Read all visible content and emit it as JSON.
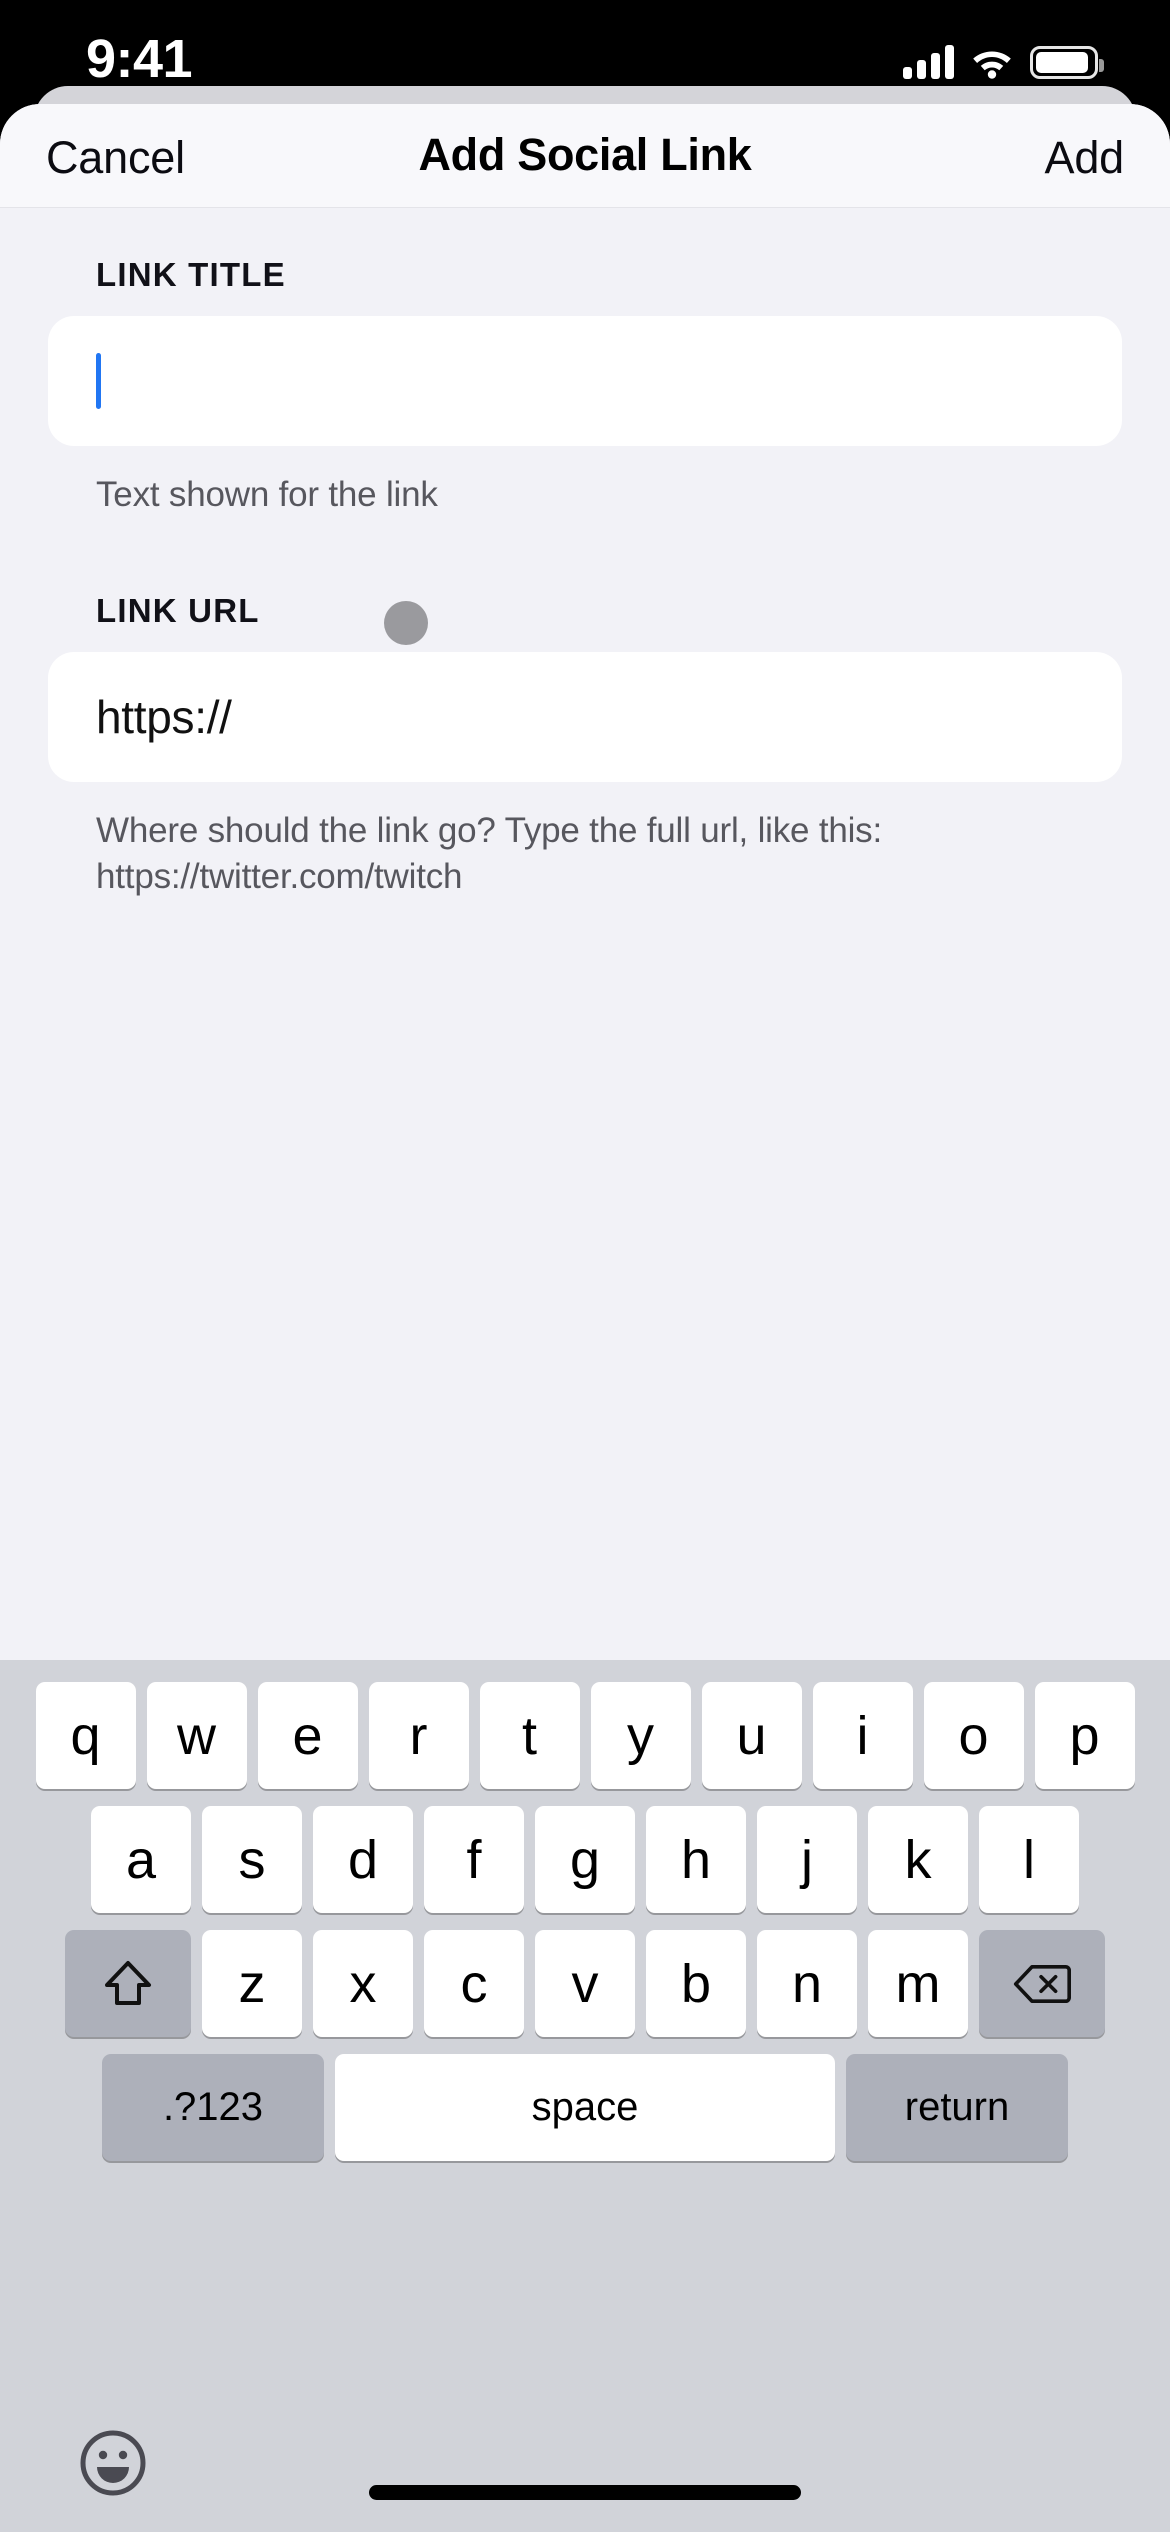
{
  "status_bar": {
    "time": "9:41",
    "cellular_icon": "cellular-bars-icon",
    "wifi_icon": "wifi-icon",
    "battery_icon": "battery-icon"
  },
  "nav_bar": {
    "cancel_label": "Cancel",
    "title": "Add Social Link",
    "add_label": "Add"
  },
  "form": {
    "title_field": {
      "label": "LINK TITLE",
      "value": "",
      "placeholder": "",
      "help": "Text shown for the link"
    },
    "url_field": {
      "label": "LINK URL",
      "value": "https://",
      "placeholder": "https://",
      "help": "Where should the link go? Type the full url, like this: https://twitter.com/twitch"
    }
  },
  "keyboard": {
    "row1": [
      "q",
      "w",
      "e",
      "r",
      "t",
      "y",
      "u",
      "i",
      "o",
      "p"
    ],
    "row2": [
      "a",
      "s",
      "d",
      "f",
      "g",
      "h",
      "j",
      "k",
      "l"
    ],
    "row3_letters": [
      "z",
      "x",
      "c",
      "v",
      "b",
      "n",
      "m"
    ],
    "shift_key": "shift-icon",
    "backspace_key": "backspace-icon",
    "numbers_key": ".?123",
    "space_key": "space",
    "return_key": "return",
    "emoji_key": "emoji-smiley-icon"
  },
  "colors": {
    "accent": "#2176f3",
    "sheet_background": "#f2f2f7",
    "navbar_background": "#f8f8fb",
    "input_background": "#ffffff",
    "keyboard_background": "#d1d3d9",
    "key_background": "#ffffff",
    "function_key_background": "#adb0ba",
    "help_text": "#57575e",
    "touch_indicator": "#9a9a9e"
  }
}
